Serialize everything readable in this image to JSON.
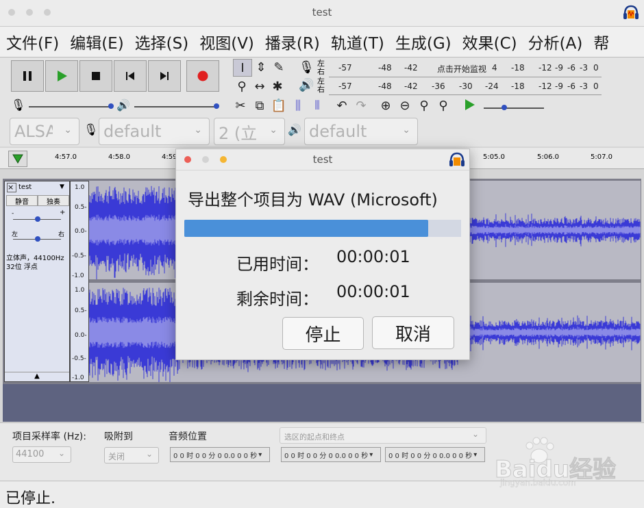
{
  "window": {
    "title": "test"
  },
  "menubar": {
    "items": [
      "文件(F)",
      "编辑(E)",
      "选择(S)",
      "视图(V)",
      "播录(R)",
      "轨道(T)",
      "生成(G)",
      "效果(C)",
      "分析(A)",
      "帮"
    ]
  },
  "meters": {
    "lr_top": "左\n右",
    "lr_bottom": "左\n右",
    "record_scale": [
      "-57",
      "-48",
      "-42",
      "点击开始监视",
      "4",
      "-18",
      "-12",
      "-9",
      "-6",
      "-3",
      "0"
    ],
    "play_scale": [
      "-57",
      "-48",
      "-42",
      "-36",
      "-30",
      "-24",
      "-18",
      "-12",
      "-9",
      "-6",
      "-3",
      "0"
    ]
  },
  "devices": {
    "host": "ALSA",
    "recording": "default",
    "channels": "2 (立",
    "playback": "default"
  },
  "timeline": {
    "ticks": [
      "4:57.0",
      "4:58.0",
      "4:59",
      "5:05.0",
      "5:06.0",
      "5:07.0"
    ]
  },
  "track": {
    "name": "test",
    "mute": "静音",
    "solo": "独奏",
    "gain_minus": "-",
    "gain_plus": "+",
    "pan_left": "左",
    "pan_right": "右",
    "info_line1": "立体声，44100Hz",
    "info_line2": "32位 浮点",
    "scale": [
      "1.0",
      "0.5-",
      "0.0-",
      "-0.5-",
      "-1.0"
    ]
  },
  "dialog": {
    "title": "test",
    "heading": "导出整个项目为 WAV (Microsoft)",
    "progress": 0.88,
    "elapsed_label": "已用时间：",
    "elapsed_value": "00:00:01",
    "remaining_label": "剩余时间：",
    "remaining_value": "00:00:01",
    "stop_button": "停止",
    "cancel_button": "取消"
  },
  "selection": {
    "rate_label": "项目采样率 (Hz):",
    "rate_value": "44100",
    "snap_label": "吸附到",
    "snap_value": "关闭",
    "audio_pos_label": "音频位置",
    "range_mode": "选区的起点和终点",
    "timecode": "0 0 时 0 0 分 0 0.0 0 0 秒"
  },
  "status": {
    "text": "已停止."
  },
  "watermark": {
    "brand": "Baidu经验",
    "url": "jingyan.baidu.com"
  },
  "colors": {
    "wave": "#3a3ad6",
    "wave_light": "#8a8ae6",
    "progress": "#4a90d9",
    "record": "#e02020",
    "play": "#2aa02a"
  }
}
